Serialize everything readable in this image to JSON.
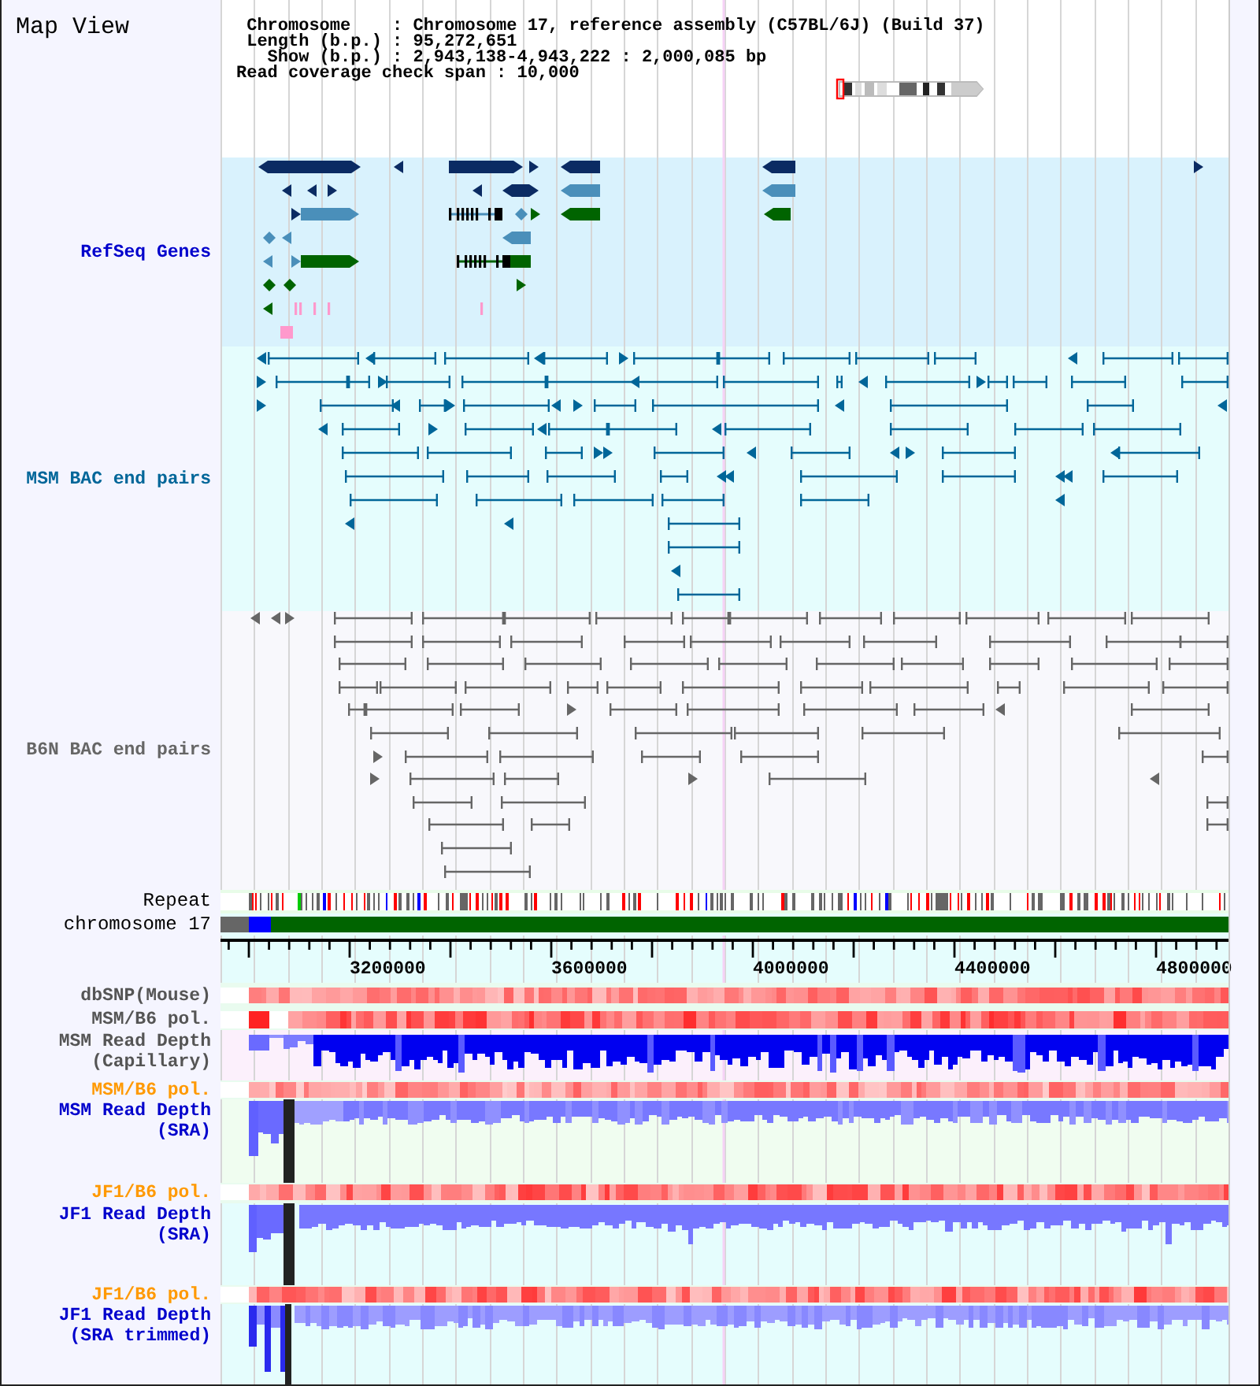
{
  "title": "Map View",
  "summary": {
    "lines": [
      " Chromosome    : Chromosome 17, reference assembly (C57BL/6J) (Build 37)",
      " Length (b.p.) : 95,272,651",
      "   Show (b.p.) : 2,943,138-4,943,222 : 2,000,085 bp",
      "Read coverage check span : 10,000"
    ]
  },
  "tracks": [
    {
      "kind": "genes",
      "label": [
        "RefSeq Genes"
      ],
      "color": "#0000cc"
    },
    {
      "kind": "bac_pairs",
      "label": [
        "MSM BAC end pairs"
      ],
      "color": "#006699"
    },
    {
      "kind": "bac_pairs",
      "label": [
        "B6N BAC end pairs"
      ],
      "color": "#666666"
    },
    {
      "kind": "repeat",
      "label": [
        "Repeat"
      ],
      "color": "#000000"
    },
    {
      "kind": "chromosome",
      "label": [
        "chromosome 17"
      ],
      "color": "#000000"
    },
    {
      "kind": "axis",
      "labels": [
        "3200000",
        "3600000",
        "4000000",
        "4400000",
        "4800000"
      ]
    },
    {
      "kind": "heat",
      "label": [
        "dbSNP(Mouse)"
      ],
      "color": "#555555"
    },
    {
      "kind": "heat",
      "label": [
        "MSM/B6 pol."
      ],
      "color": "#555555"
    },
    {
      "kind": "depth",
      "label": [
        "MSM Read Depth",
        "(Capillary)"
      ],
      "color": "#555555"
    },
    {
      "kind": "heat",
      "label": [
        "MSM/B6 pol."
      ],
      "color": "#ff9900"
    },
    {
      "kind": "depth",
      "label": [
        "MSM Read Depth",
        "(SRA)"
      ],
      "color": "#0000cc"
    },
    {
      "kind": "heat",
      "label": [
        "JF1/B6 pol."
      ],
      "color": "#ff9900"
    },
    {
      "kind": "depth",
      "label": [
        "JF1 Read Depth",
        "(SRA)"
      ],
      "color": "#0000cc"
    },
    {
      "kind": "heat",
      "label": [
        "JF1/B6 pol."
      ],
      "color": "#ff9900"
    },
    {
      "kind": "depth",
      "label": [
        "JF1 Read Depth",
        "(SRA trimmed)"
      ],
      "color": "#0000cc"
    }
  ]
}
